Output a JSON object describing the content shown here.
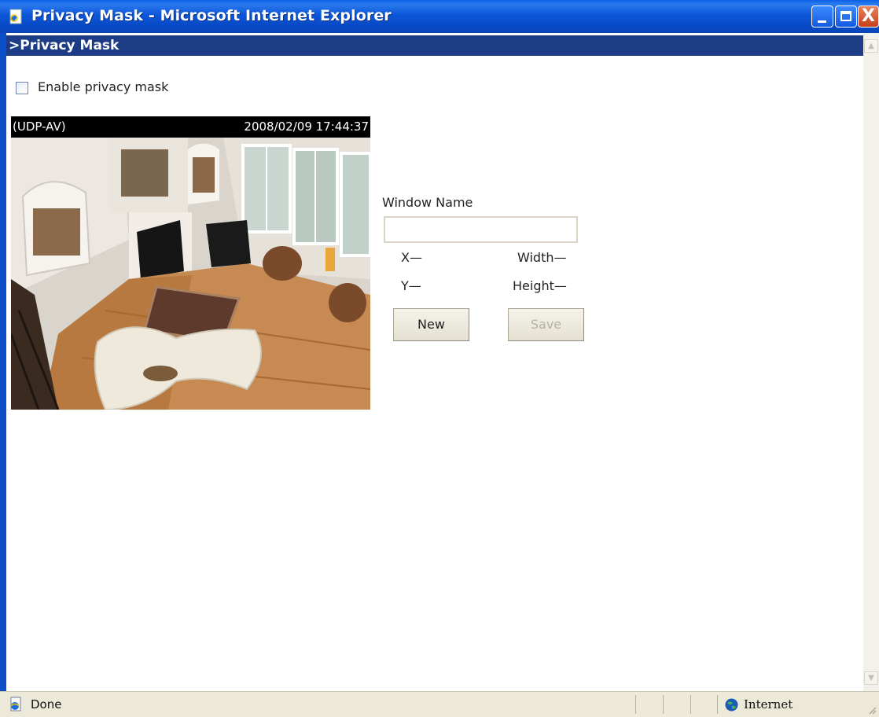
{
  "window": {
    "title": "Privacy Mask - Microsoft Internet Explorer",
    "title_icon": "ie-page-icon",
    "controls": [
      "minimize-icon",
      "maximize-icon",
      "close-icon"
    ],
    "close_glyph": "X"
  },
  "page": {
    "header": ">Privacy Mask",
    "enable_checkbox": {
      "label": "Enable privacy mask",
      "checked": false
    }
  },
  "camera": {
    "mode": "(UDP-AV)",
    "timestamp": "2008/02/09 17:44:37",
    "scene": "live-video-living-room"
  },
  "mask_form": {
    "window_name_label": "Window Name",
    "window_name_value": "",
    "x_label": "X—",
    "y_label": "Y—",
    "width_label": "Width—",
    "height_label": "Height—",
    "new_button": "New",
    "save_button": "Save",
    "save_enabled": false
  },
  "statusbar": {
    "status": "Done",
    "zone": "Internet",
    "zone_icon": "globe-icon"
  },
  "colors": {
    "titlebar": "#0a5fe6",
    "page_header": "#1c3c86",
    "chrome": "#ece9d8"
  }
}
